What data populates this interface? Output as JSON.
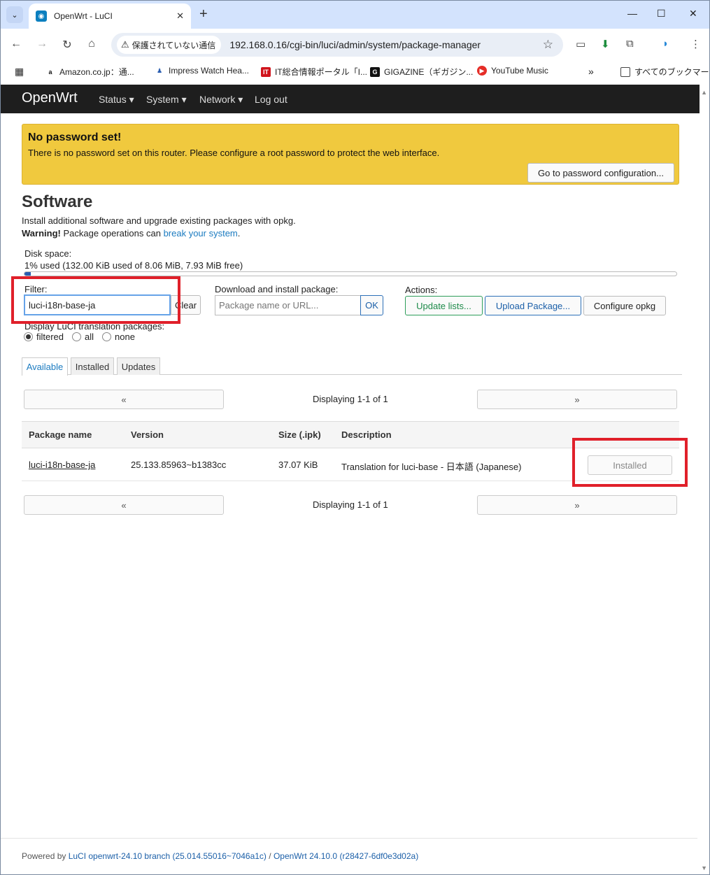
{
  "browser": {
    "tab_title": "OpenWrt - LuCI",
    "security_chip": "保護されていない通信",
    "url": "192.168.0.16/cgi-bin/luci/admin/system/package-manager",
    "bookmarks": [
      {
        "label": "Amazon.co.jp：通..."
      },
      {
        "label": "Impress Watch Hea..."
      },
      {
        "label": "IT総合情報ポータル「I..."
      },
      {
        "label": "GIGAZINE（ギガジン..."
      },
      {
        "label": "YouTube Music"
      }
    ],
    "all_bookmarks": "すべてのブックマーク",
    "overflow": "»"
  },
  "header": {
    "brand": "OpenWrt",
    "menu": [
      {
        "label": "Status ▾"
      },
      {
        "label": "System ▾"
      },
      {
        "label": "Network ▾"
      },
      {
        "label": "Log out"
      }
    ]
  },
  "alert": {
    "title": "No password set!",
    "message": "There is no password set on this router. Please configure a root password to protect the web interface.",
    "button": "Go to password configuration..."
  },
  "page": {
    "title": "Software",
    "description": "Install additional software and upgrade existing packages with opkg.",
    "warning_bold": "Warning!",
    "warning_text": " Package operations can ",
    "warning_link": "break your system",
    "warning_end": "."
  },
  "disk": {
    "label": "Disk space:",
    "value": "1% used (132.00 KiB used of 8.06 MiB, 7.93 MiB free)",
    "used_percent": 1
  },
  "filter": {
    "label": "Filter:",
    "value": "luci-i18n-base-ja",
    "clear": "Clear"
  },
  "download": {
    "label": "Download and install package:",
    "placeholder": "Package name or URL...",
    "ok": "OK"
  },
  "actions": {
    "label": "Actions:",
    "update": "Update lists...",
    "upload": "Upload Package...",
    "configure": "Configure opkg"
  },
  "translation": {
    "label": "Display LuCI translation packages:",
    "options": [
      "filtered",
      "all",
      "none"
    ],
    "selected": "filtered"
  },
  "tabs": [
    "Available",
    "Installed",
    "Updates"
  ],
  "pager": {
    "prev": "«",
    "next": "»",
    "text": "Displaying 1-1 of 1"
  },
  "table": {
    "headers": [
      "Package name",
      "Version",
      "Size (.ipk)",
      "Description"
    ],
    "rows": [
      {
        "name": "luci-i18n-base-ja",
        "version": "25.133.85963~b1383cc",
        "size": "37.07 KiB",
        "description": "Translation for luci-base - 日本語 (Japanese)",
        "action": "Installed"
      }
    ]
  },
  "footer": {
    "powered": "Powered by ",
    "luci": "LuCI openwrt-24.10 branch (25.014.55016~7046a1c)",
    "sep": " / ",
    "openwrt": "OpenWrt 24.10.0 (r28427-6df0e3d02a)"
  },
  "colors": {
    "alert_bg": "#f0c93e",
    "header_bg": "#1e1e1e",
    "link": "#1b7bc0",
    "highlight_box": "#e0202a"
  }
}
